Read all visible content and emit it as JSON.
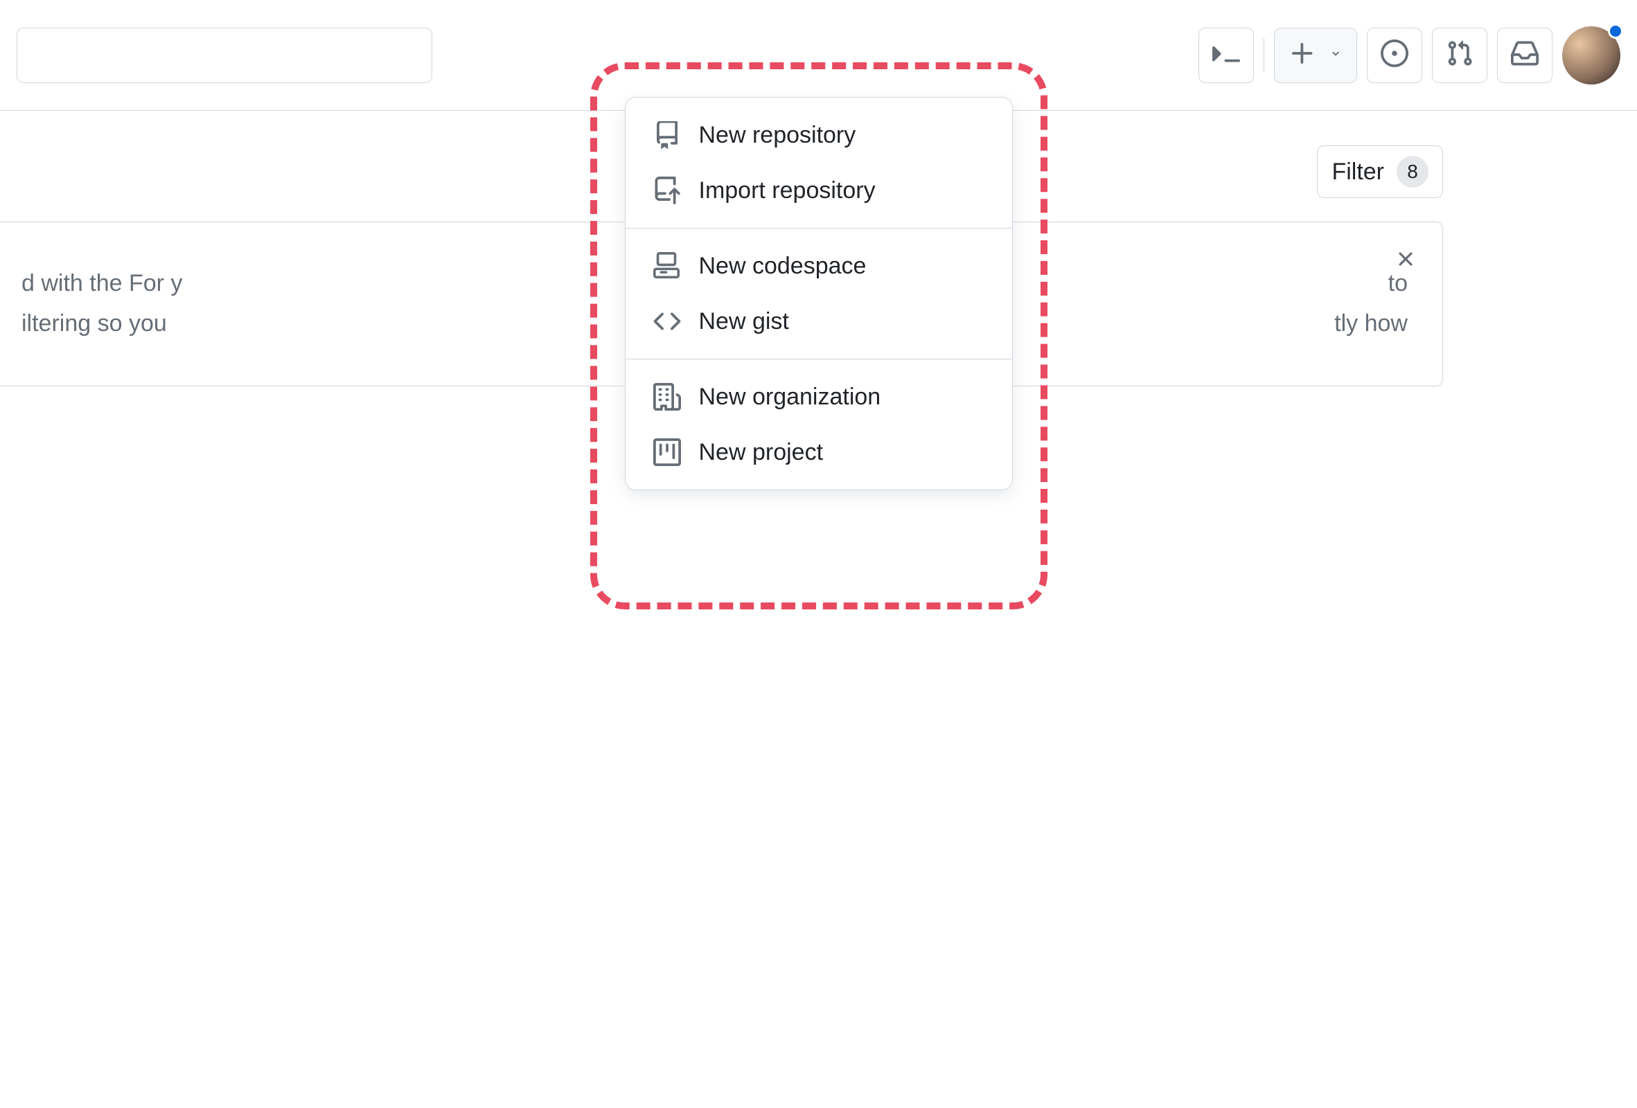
{
  "header": {
    "search_placeholder": ""
  },
  "dropdown": {
    "sections": [
      {
        "items": [
          {
            "icon": "repo-icon",
            "label": "New repository"
          },
          {
            "icon": "repo-push-icon",
            "label": "Import repository"
          }
        ]
      },
      {
        "items": [
          {
            "icon": "codespaces-icon",
            "label": "New codespace"
          },
          {
            "icon": "code-icon",
            "label": "New gist"
          }
        ]
      },
      {
        "items": [
          {
            "icon": "organization-icon",
            "label": "New organization"
          },
          {
            "icon": "project-icon",
            "label": "New project"
          }
        ]
      }
    ]
  },
  "filter": {
    "label": "Filter",
    "count": "8"
  },
  "card": {
    "line1": "d with the For y",
    "line2": "iltering so you",
    "line3": "to",
    "line4": "tly how"
  }
}
